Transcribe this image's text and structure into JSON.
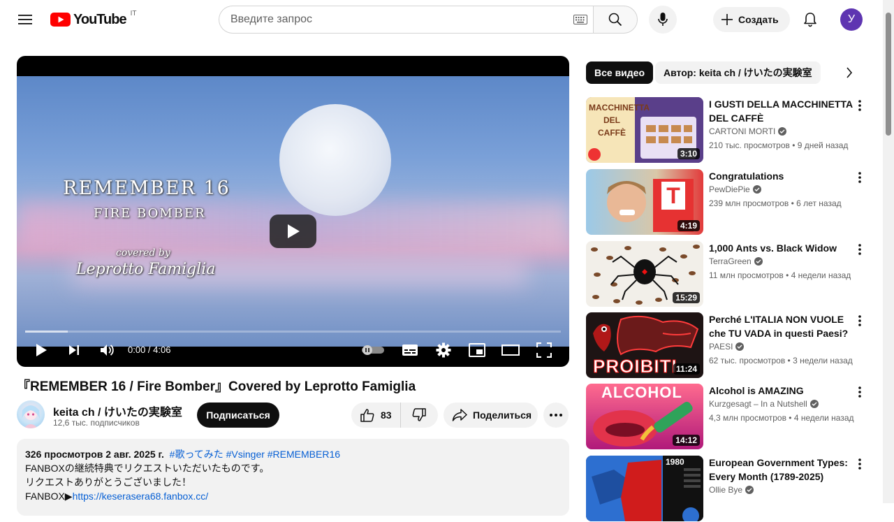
{
  "header": {
    "logo_text": "YouTube",
    "country_code": "IT",
    "search_placeholder": "Введите запрос",
    "create_label": "Создать",
    "avatar_letter": "У"
  },
  "player": {
    "overlay": {
      "title": "REMEMBER 16",
      "artist": "FIRE BOMBER",
      "covered_by": "covered by",
      "performer": "Leprotto Famiglia"
    },
    "time_display": "0:00 / 4:06",
    "progress_fraction": 0.08
  },
  "video": {
    "title": "『REMEMBER 16 / Fire Bomber』Covered by Leprotto Famiglia",
    "channel_name": "keita ch / けいたの実験室",
    "subscribers": "12,6 тыс. подписчиков",
    "subscribe_label": "Подписаться",
    "likes": "83",
    "share_label": "Поделиться",
    "description": {
      "meta": "326 просмотров  2 авг. 2025 г.",
      "tags": "#歌ってみた #Vsinger #REMEMBER16",
      "line1": "FANBOXの継続特典でリクエストいただいたものです。",
      "line2": "リクエストありがとうございました！",
      "line3_prefix": "FANBOX▶",
      "line3_link": "https://keserasera68.fanbox.cc/"
    }
  },
  "sidebar": {
    "chips": [
      "Все видео",
      "Автор: keita ch / けいたの実験室"
    ],
    "recommendations": [
      {
        "title": "I GUSTI DELLA MACCHINETTA DEL CAFFÈ",
        "channel": "CARTONI MORTI",
        "verified": true,
        "stats": "210 тыс. просмотров • 9 дней назад",
        "duration": "3:10",
        "thumb_text": "MACCHINETTA DEL CAFFÈ"
      },
      {
        "title": "Congratulations",
        "channel": "PewDiePie",
        "verified": true,
        "stats": "239 млн просмотров • 6 лет назад",
        "duration": "4:19",
        "thumb_text": "T"
      },
      {
        "title": "1,000 Ants vs. Black Widow",
        "channel": "TerraGreen",
        "verified": true,
        "stats": "11 млн просмотров • 4 недели назад",
        "duration": "15:29",
        "thumb_text": ""
      },
      {
        "title": "Perché L'ITALIA NON VUOLE che TU VADA in questi Paesi?",
        "channel": "PAESI",
        "verified": true,
        "stats": "62 тыс. просмотров • 3 недели назад",
        "duration": "11:24",
        "thumb_text": "PROIBITI"
      },
      {
        "title": "Alcohol is AMAZING",
        "channel": "Kurzgesagt – In a Nutshell",
        "verified": true,
        "stats": "4,3 млн просмотров • 4 недели назад",
        "duration": "14:12",
        "thumb_text": "ALCOHOL"
      },
      {
        "title": "European Government Types: Every Month (1789-2025)",
        "channel": "Ollie Bye",
        "verified": true,
        "stats": "",
        "duration": "",
        "thumb_text": "1980"
      }
    ]
  }
}
